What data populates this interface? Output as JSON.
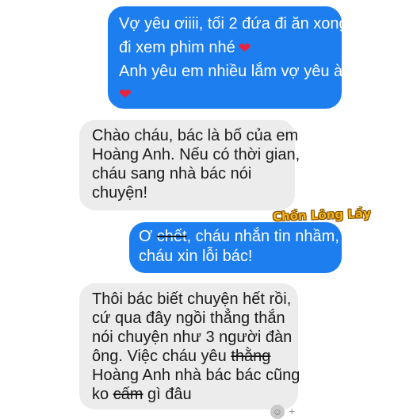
{
  "messages": [
    {
      "direction": "outgoing",
      "lines": [
        "Vợ yêu ơiiii, tối 2 đứa đi ăn xong",
        "đi xem phim nhé",
        "Anh yêu em nhiều lắm vợ yêu à",
        ""
      ],
      "heart_icon": "❤"
    },
    {
      "direction": "incoming",
      "lines": [
        "Chào cháu, bác là bố của em",
        "Hoàng Anh. Nếu có thời gian,",
        "cháu sang nhà bác nói",
        "chuyện!"
      ]
    },
    {
      "direction": "outgoing",
      "line1_prefix": "Ơ ",
      "line1_struck": "chết",
      "line1_suffix": ", cháu nhắn tin nhầm,",
      "line2": "cháu xin lỗi bác!"
    },
    {
      "direction": "incoming",
      "lines": [
        "Thôi bác biết chuyện hết rồi,",
        "cứ qua đây ngồi thẳng thắn",
        "nói chuyện như 3 người đàn"
      ],
      "line4_prefix": "ông. Việc cháu yêu ",
      "line4_struck": "thằng",
      "line5": "Hoàng Anh nhà bác bác cũng",
      "line6_prefix": "ko ",
      "line6_struck": "cấm",
      "line6_suffix": " gì đâu"
    }
  ],
  "watermark": "Chồn Lông Lầy",
  "colors": {
    "outgoing_bubble": "#1d7ef0",
    "incoming_bubble": "#ececec",
    "heart": "#e8243a",
    "watermark": "#f3b417"
  },
  "icons": {
    "emoji": "☺",
    "add": "+"
  }
}
